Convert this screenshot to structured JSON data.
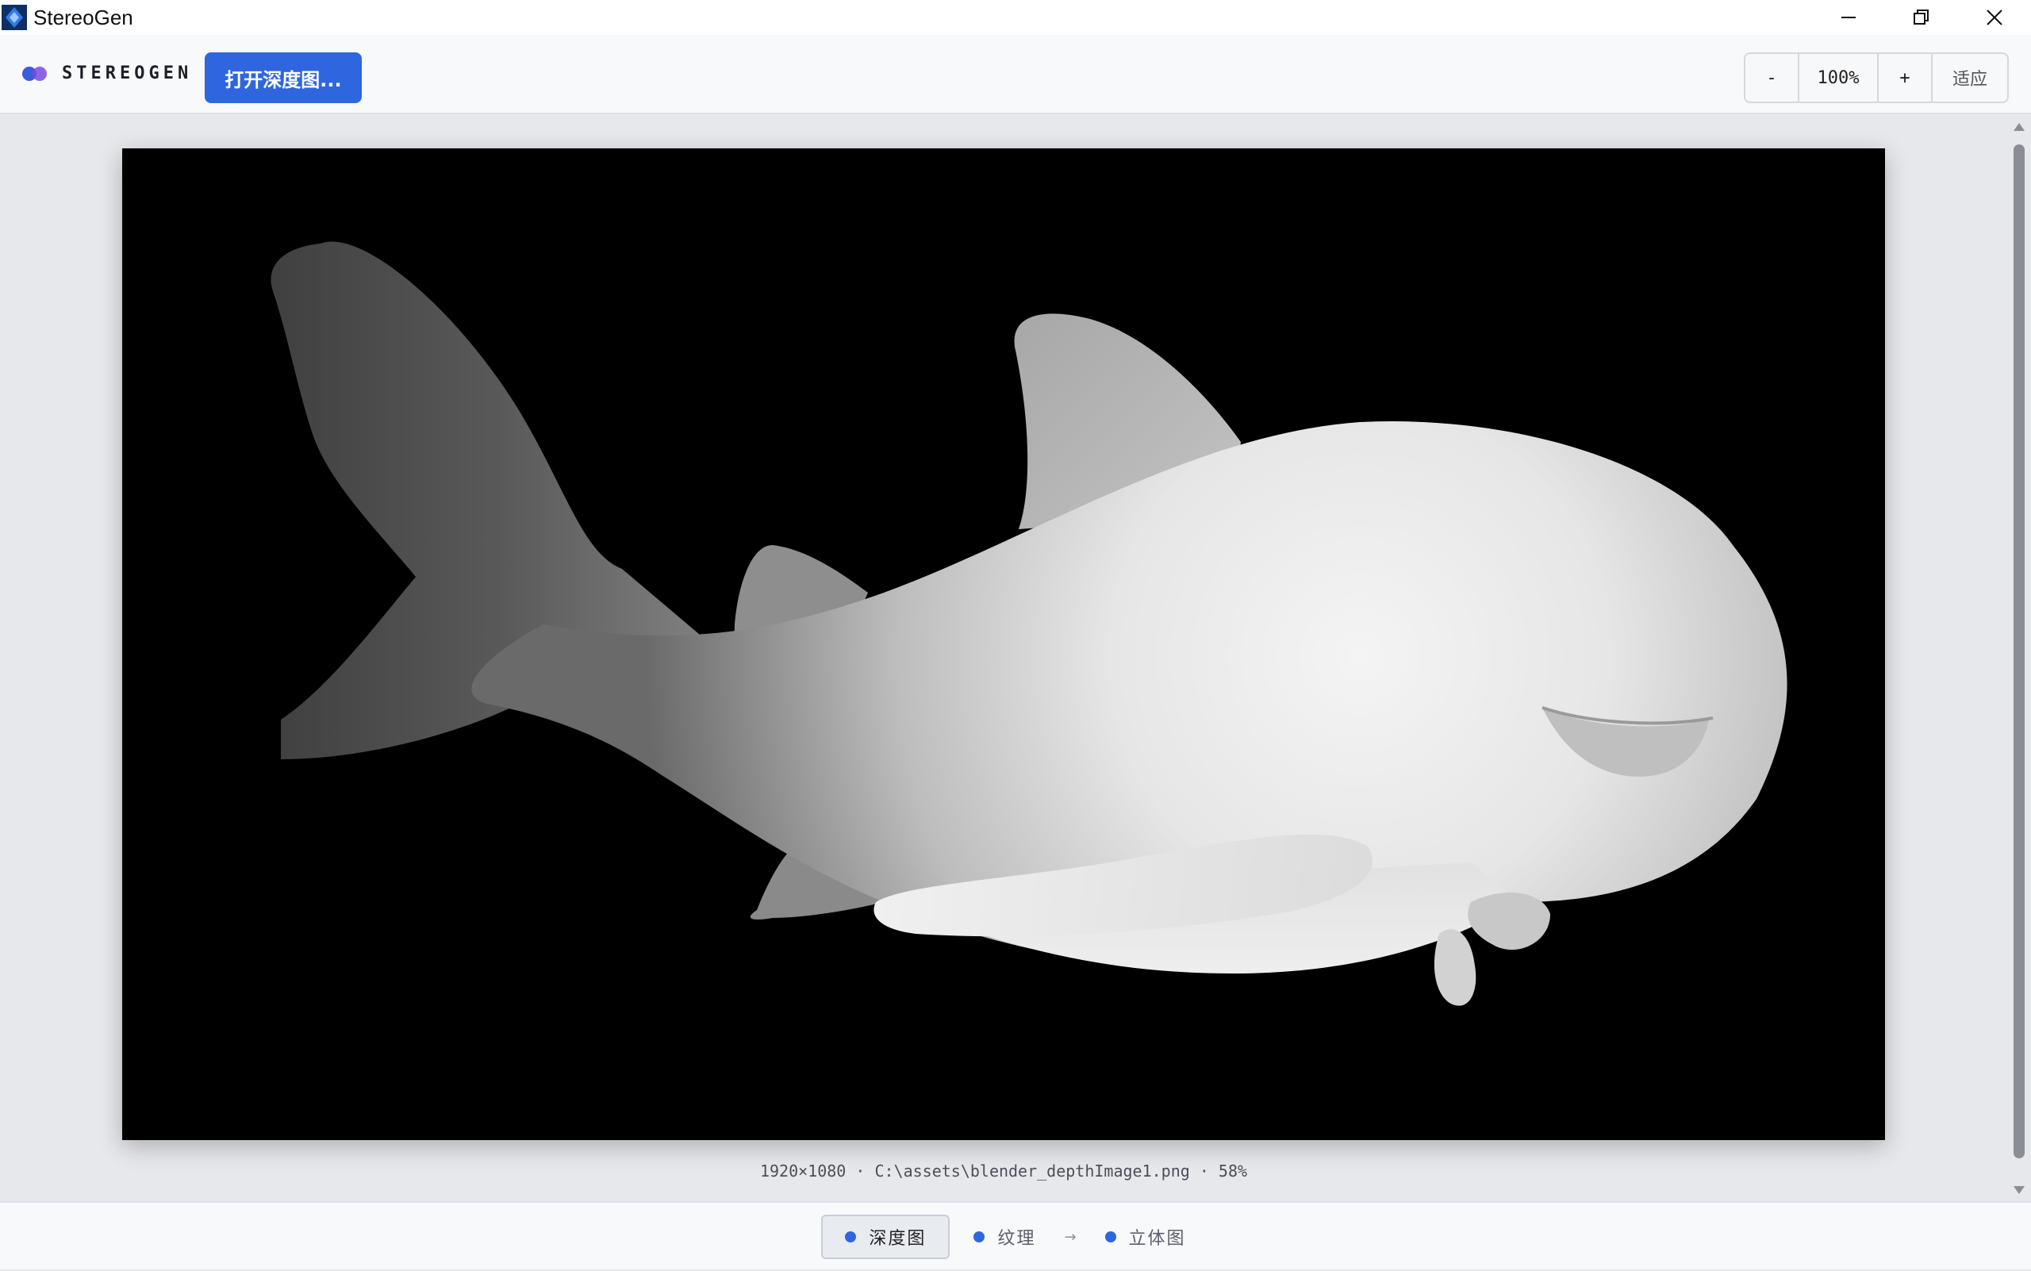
{
  "window": {
    "title": "StereoGen",
    "app_icon": "stereogen-app-icon",
    "controls": [
      "minimize-icon",
      "restore-icon",
      "close-icon"
    ]
  },
  "toolbar": {
    "brand": "STEREOGEN",
    "open_button": "打开深度图...",
    "zoom": {
      "minus": "-",
      "value": "100%",
      "plus": "+",
      "fit": "适应"
    }
  },
  "viewer": {
    "image_subject": "shark depth map (grayscale)",
    "info": "1920×1080 · C:\\assets\\blender_depthImage1.png · 58%"
  },
  "pipeline": {
    "steps": [
      {
        "label": "深度图",
        "active": true
      },
      {
        "label": "纹理",
        "active": false
      },
      {
        "label": "立体图",
        "active": false
      }
    ],
    "arrow": "→"
  },
  "colors": {
    "accent": "#2f66e0",
    "brand_blue": "#3b5bdb",
    "brand_purple": "#7b4ae0"
  }
}
